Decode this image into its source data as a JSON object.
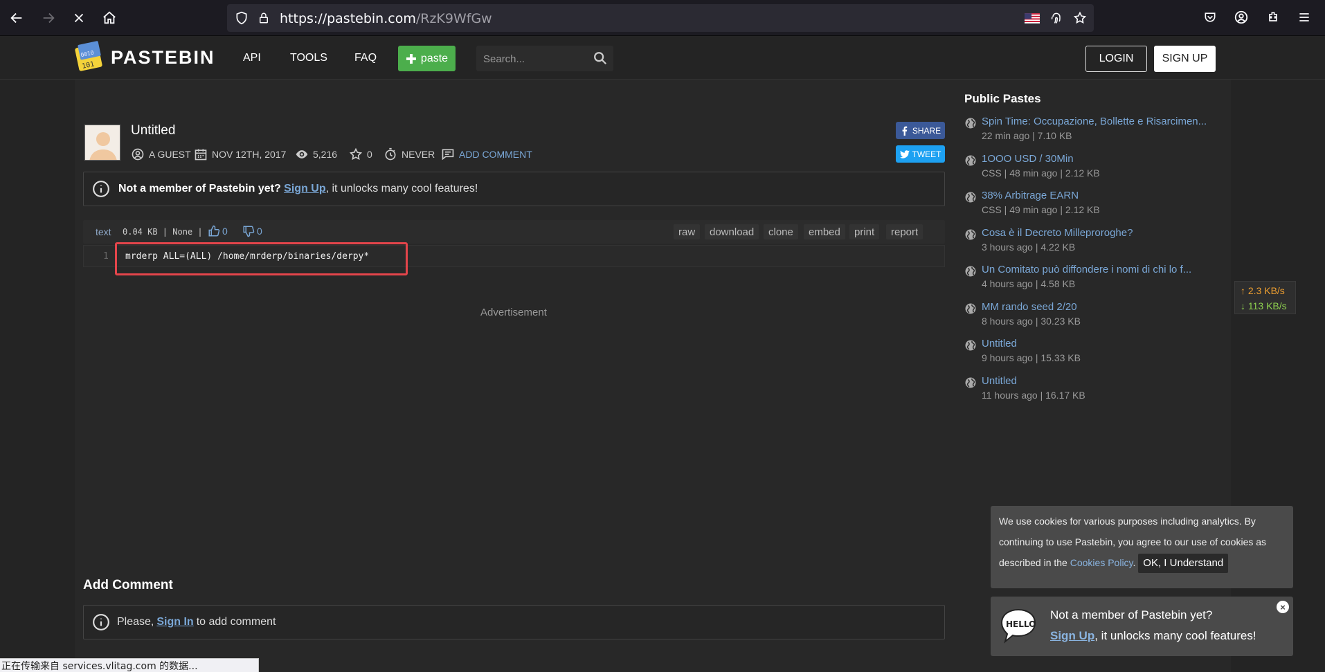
{
  "browser": {
    "url_host": "https://pastebin.com",
    "url_path": "/RzK9WfGw"
  },
  "header": {
    "logo_text": "PASTEBIN",
    "nav": [
      "API",
      "TOOLS",
      "FAQ"
    ],
    "paste_button": "paste",
    "search_placeholder": "Search...",
    "login": "LOGIN",
    "signup": "SIGN UP"
  },
  "paste": {
    "title": "Untitled",
    "author": "A GUEST",
    "date": "NOV 12TH, 2017",
    "views": "5,216",
    "stars": "0",
    "expiry": "NEVER",
    "add_comment": "ADD COMMENT",
    "share": "SHARE",
    "tweet": "TWEET"
  },
  "notice": {
    "bold": "Not a member of Pastebin yet?",
    "link": "Sign Up",
    "rest": ", it unlocks many cool features!"
  },
  "code": {
    "lang": "text",
    "info": "0.04 KB | None |",
    "likes": "0",
    "dislikes": "0",
    "actions": [
      "raw",
      "download",
      "clone",
      "embed",
      "print",
      "report"
    ],
    "line_number": "1",
    "line": "mrderp ALL=(ALL) /home/mrderp/binaries/derpy*"
  },
  "advertisement": "Advertisement",
  "add_comment": {
    "heading": "Add Comment",
    "pre": "Please,",
    "link": "Sign In",
    "post": "to add comment"
  },
  "sidebar": {
    "title": "Public Pastes",
    "items": [
      {
        "title": "Spin Time: Occupazione, Bollette e Risarcimen...",
        "meta": "22 min ago | 7.10 KB"
      },
      {
        "title": "1OOO USD / 30Min",
        "meta": "CSS | 48 min ago | 2.12 KB"
      },
      {
        "title": "38% Arbitrage EARN",
        "meta": "CSS | 49 min ago | 2.12 KB"
      },
      {
        "title": "Cosa è il Decreto Milleproroghe?",
        "meta": "3 hours ago | 4.22 KB"
      },
      {
        "title": "Un Comitato può diffondere i nomi di chi lo f...",
        "meta": "4 hours ago | 4.58 KB"
      },
      {
        "title": "MM rando seed 2/20",
        "meta": "8 hours ago | 30.23 KB"
      },
      {
        "title": "Untitled",
        "meta": "9 hours ago | 15.33 KB"
      },
      {
        "title": "Untitled",
        "meta": "11 hours ago | 16.17 KB"
      }
    ]
  },
  "speed": {
    "up": "↑ 2.3 KB/s",
    "down": "↓ 113 KB/s"
  },
  "cookie": {
    "text_before": "We use cookies for various purposes including analytics. By continuing to use Pastebin, you agree to our use of cookies as described in the",
    "link": "Cookies Policy",
    "ok": "OK, I Understand"
  },
  "member_popup": {
    "line1": "Not a member of Pastebin yet?",
    "link": "Sign Up",
    "rest": ", it unlocks many cool features!"
  },
  "status_bar": "正在传输来自 services.vlitag.com 的数据..."
}
